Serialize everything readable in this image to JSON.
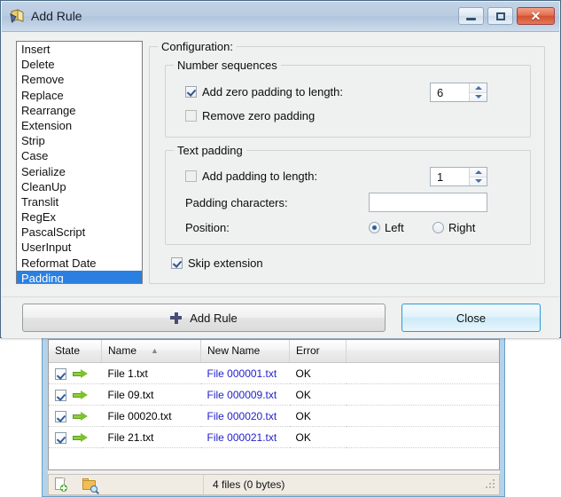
{
  "dialog": {
    "title": "Add Rule",
    "icon": "add-rule-icon",
    "window_buttons": {
      "minimize": "minimize-icon",
      "maximize": "maximize-icon",
      "close": "close-icon"
    },
    "rule_list": [
      {
        "label": "Insert",
        "selected": false
      },
      {
        "label": "Delete",
        "selected": false
      },
      {
        "label": "Remove",
        "selected": false
      },
      {
        "label": "Replace",
        "selected": false
      },
      {
        "label": "Rearrange",
        "selected": false
      },
      {
        "label": "Extension",
        "selected": false
      },
      {
        "label": "Strip",
        "selected": false
      },
      {
        "label": "Case",
        "selected": false
      },
      {
        "label": "Serialize",
        "selected": false
      },
      {
        "label": "CleanUp",
        "selected": false
      },
      {
        "label": "Translit",
        "selected": false
      },
      {
        "label": "RegEx",
        "selected": false
      },
      {
        "label": "PascalScript",
        "selected": false
      },
      {
        "label": "UserInput",
        "selected": false
      },
      {
        "label": "Reformat Date",
        "selected": false
      },
      {
        "label": "Padding",
        "selected": true
      }
    ],
    "configuration": {
      "title": "Configuration:",
      "number_sequences": {
        "title": "Number sequences",
        "add_zero_padding_label": "Add zero padding to length:",
        "add_zero_padding_checked": true,
        "add_zero_padding_value": "6",
        "remove_zero_padding_label": "Remove zero padding",
        "remove_zero_padding_checked": false
      },
      "text_padding": {
        "title": "Text padding",
        "add_padding_label": "Add padding to length:",
        "add_padding_checked": false,
        "add_padding_value": "1",
        "padding_chars_label": "Padding characters:",
        "padding_chars_value": "",
        "position_label": "Position:",
        "position_left_label": "Left",
        "position_right_label": "Right",
        "position_selected": "Left"
      },
      "skip_extension_label": "Skip extension",
      "skip_extension_checked": true
    },
    "buttons": {
      "add_rule": "Add Rule",
      "close": "Close"
    }
  },
  "file_window": {
    "columns": [
      "State",
      "Name",
      "New Name",
      "Error"
    ],
    "sorted_column": "Name",
    "sort_direction": "ascending",
    "rows": [
      {
        "state_checked": true,
        "name": "File 1.txt",
        "new_name": "File 000001.txt",
        "error": "OK"
      },
      {
        "state_checked": true,
        "name": "File 09.txt",
        "new_name": "File 000009.txt",
        "error": "OK"
      },
      {
        "state_checked": true,
        "name": "File 00020.txt",
        "new_name": "File 000020.txt",
        "error": "OK"
      },
      {
        "state_checked": true,
        "name": "File 21.txt",
        "new_name": "File 000021.txt",
        "error": "OK"
      }
    ],
    "statusbar": {
      "new_file_icon": "new-file-icon",
      "browse_folder_icon": "browse-folder-icon",
      "summary": "4 files (0 bytes)"
    }
  },
  "colors": {
    "selection_blue": "#2b7fe0",
    "new_name_text": "#2222cc",
    "close_button_border": "#2a9ad6",
    "title_gradient_top": "#c3d3e6"
  }
}
